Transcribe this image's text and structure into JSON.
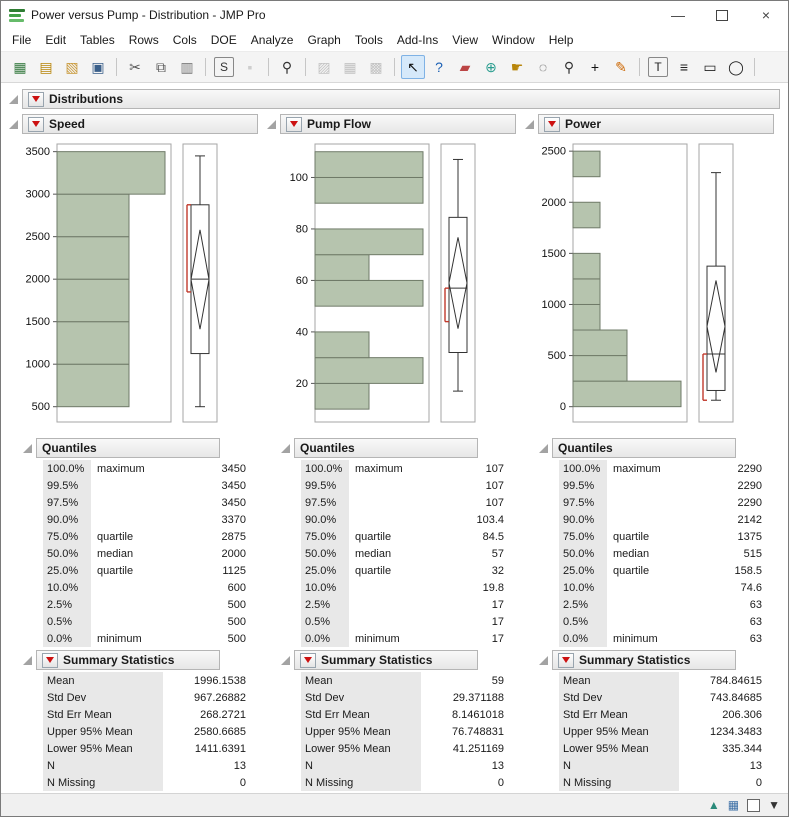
{
  "window": {
    "title": "Power versus Pump - Distribution - JMP Pro",
    "minimize_glyph": "—",
    "close_glyph": "×"
  },
  "menu": [
    "File",
    "Edit",
    "Tables",
    "Rows",
    "Cols",
    "DOE",
    "Analyze",
    "Graph",
    "Tools",
    "Add-Ins",
    "View",
    "Window",
    "Help"
  ],
  "toolbar": {
    "items": [
      {
        "name": "new-data-table-icon",
        "glyph": "▦",
        "color": "#3a7d44"
      },
      {
        "name": "new-journal-icon",
        "glyph": "▤",
        "color": "#b8860b"
      },
      {
        "name": "open-icon",
        "glyph": "▧",
        "color": "#c89838"
      },
      {
        "name": "save-icon",
        "glyph": "▣",
        "color": "#3a5f8a"
      },
      {
        "sep": true
      },
      {
        "name": "cut-icon",
        "glyph": "✂",
        "color": "#555555"
      },
      {
        "name": "copy-icon",
        "glyph": "⧉",
        "color": "#555555"
      },
      {
        "name": "paste-icon",
        "glyph": "▥",
        "color": "#777777"
      },
      {
        "sep": true
      },
      {
        "name": "copy-script-icon",
        "glyph": "S",
        "color": "#333333",
        "boxed": true
      },
      {
        "name": "lock-icon",
        "glyph": "▪",
        "color": "#888888",
        "disabled": true
      },
      {
        "sep": true
      },
      {
        "name": "search-icon",
        "glyph": "⚲",
        "color": "#333333"
      },
      {
        "sep": true
      },
      {
        "name": "paste-special-icon",
        "glyph": "▨",
        "disabled": true,
        "color": "#666666"
      },
      {
        "name": "copy-table-icon",
        "glyph": "▦",
        "disabled": true,
        "color": "#666666"
      },
      {
        "name": "copy-graph-icon",
        "glyph": "▩",
        "disabled": true,
        "color": "#666666"
      },
      {
        "sep": true
      },
      {
        "name": "arrow-tool-icon",
        "glyph": "↖",
        "selected": true,
        "color": "#111111"
      },
      {
        "name": "help-tool-icon",
        "glyph": "?",
        "color": "#1a5fb4"
      },
      {
        "name": "brush-tool-icon",
        "glyph": "▰",
        "color": "#bb4444"
      },
      {
        "name": "globe-icon",
        "glyph": "⊕",
        "color": "#2a9d8f"
      },
      {
        "name": "grabber-tool-icon",
        "glyph": "☛",
        "color": "#b8860b"
      },
      {
        "name": "lasso-tool-icon",
        "glyph": "◌",
        "color": "#333333"
      },
      {
        "name": "magnifier-tool-icon",
        "glyph": "⚲",
        "color": "#333333"
      },
      {
        "name": "crosshair-tool-icon",
        "glyph": "+",
        "color": "#111111"
      },
      {
        "name": "pencil-tool-icon",
        "glyph": "✎",
        "color": "#cc6600"
      },
      {
        "sep": true
      },
      {
        "name": "annotate-icon",
        "glyph": "T",
        "color": "#222222",
        "boxed": true
      },
      {
        "name": "line-annotation-icon",
        "glyph": "≡",
        "color": "#222222"
      },
      {
        "name": "rectangle-annotation-icon",
        "glyph": "▭",
        "color": "#222222"
      },
      {
        "name": "oval-annotation-icon",
        "glyph": "◯",
        "color": "#222222"
      },
      {
        "sep": true
      }
    ]
  },
  "report": {
    "title": "Distributions"
  },
  "colors": {
    "bar_fill": "#b6c4ae",
    "bar_stroke": "#6f7a68",
    "axis_stroke": "#a5a5a5",
    "box_stroke": "#333333",
    "bracket": "#c0392b"
  },
  "distributions": [
    {
      "name": "Speed",
      "chart_data": {
        "type": "histogram+boxplot",
        "axis": {
          "min": 320,
          "max": 3590,
          "ticks": [
            500,
            1000,
            1500,
            2000,
            2500,
            3000,
            3500
          ]
        },
        "bins": [
          {
            "lo": 500,
            "hi": 1000,
            "count": 2
          },
          {
            "lo": 1000,
            "hi": 1500,
            "count": 2
          },
          {
            "lo": 1500,
            "hi": 2000,
            "count": 2
          },
          {
            "lo": 2000,
            "hi": 2500,
            "count": 2
          },
          {
            "lo": 2500,
            "hi": 3000,
            "count": 2
          },
          {
            "lo": 3000,
            "hi": 3500,
            "count": 3
          }
        ],
        "boxplot": {
          "min": 500,
          "q1": 1125,
          "median": 2000,
          "q3": 2875,
          "max": 3450,
          "mean": 1996.1538,
          "ci_low": 1411.6391,
          "ci_high": 2580.6685,
          "shortest_half": [
            1850,
            2875
          ]
        }
      },
      "quantiles": {
        "title": "Quantiles",
        "rows": [
          [
            "100.0%",
            "maximum",
            "3450"
          ],
          [
            "99.5%",
            "",
            "3450"
          ],
          [
            "97.5%",
            "",
            "3450"
          ],
          [
            "90.0%",
            "",
            "3370"
          ],
          [
            "75.0%",
            "quartile",
            "2875"
          ],
          [
            "50.0%",
            "median",
            "2000"
          ],
          [
            "25.0%",
            "quartile",
            "1125"
          ],
          [
            "10.0%",
            "",
            "600"
          ],
          [
            "2.5%",
            "",
            "500"
          ],
          [
            "0.5%",
            "",
            "500"
          ],
          [
            "0.0%",
            "minimum",
            "500"
          ]
        ]
      },
      "summary": {
        "title": "Summary Statistics",
        "rows": [
          [
            "Mean",
            "1996.1538"
          ],
          [
            "Std Dev",
            "967.26882"
          ],
          [
            "Std Err Mean",
            "268.2721"
          ],
          [
            "Upper 95% Mean",
            "2580.6685"
          ],
          [
            "Lower 95% Mean",
            "1411.6391"
          ],
          [
            "N",
            "13"
          ],
          [
            "N Missing",
            "0"
          ]
        ]
      }
    },
    {
      "name": "Pump Flow",
      "chart_data": {
        "type": "histogram+boxplot",
        "axis": {
          "min": 5,
          "max": 113,
          "ticks": [
            20,
            40,
            60,
            80,
            100
          ]
        },
        "bins": [
          {
            "lo": 10,
            "hi": 20,
            "count": 1
          },
          {
            "lo": 20,
            "hi": 30,
            "count": 2
          },
          {
            "lo": 30,
            "hi": 40,
            "count": 1
          },
          {
            "lo": 40,
            "hi": 50,
            "count": 0
          },
          {
            "lo": 50,
            "hi": 60,
            "count": 2
          },
          {
            "lo": 60,
            "hi": 70,
            "count": 1
          },
          {
            "lo": 70,
            "hi": 80,
            "count": 2
          },
          {
            "lo": 80,
            "hi": 90,
            "count": 0
          },
          {
            "lo": 90,
            "hi": 100,
            "count": 2
          },
          {
            "lo": 100,
            "hi": 110,
            "count": 2
          }
        ],
        "boxplot": {
          "min": 17,
          "q1": 32,
          "median": 57,
          "q3": 84.5,
          "max": 107,
          "mean": 59,
          "ci_low": 41.251169,
          "ci_high": 76.748831,
          "shortest_half": [
            44,
            57
          ]
        }
      },
      "quantiles": {
        "title": "Quantiles",
        "rows": [
          [
            "100.0%",
            "maximum",
            "107"
          ],
          [
            "99.5%",
            "",
            "107"
          ],
          [
            "97.5%",
            "",
            "107"
          ],
          [
            "90.0%",
            "",
            "103.4"
          ],
          [
            "75.0%",
            "quartile",
            "84.5"
          ],
          [
            "50.0%",
            "median",
            "57"
          ],
          [
            "25.0%",
            "quartile",
            "32"
          ],
          [
            "10.0%",
            "",
            "19.8"
          ],
          [
            "2.5%",
            "",
            "17"
          ],
          [
            "0.5%",
            "",
            "17"
          ],
          [
            "0.0%",
            "minimum",
            "17"
          ]
        ]
      },
      "summary": {
        "title": "Summary Statistics",
        "rows": [
          [
            "Mean",
            "59"
          ],
          [
            "Std Dev",
            "29.371188"
          ],
          [
            "Std Err Mean",
            "8.1461018"
          ],
          [
            "Upper 95% Mean",
            "76.748831"
          ],
          [
            "Lower 95% Mean",
            "41.251169"
          ],
          [
            "N",
            "13"
          ],
          [
            "N Missing",
            "0"
          ]
        ]
      }
    },
    {
      "name": "Power",
      "chart_data": {
        "type": "histogram+boxplot",
        "axis": {
          "min": -150,
          "max": 2570,
          "ticks": [
            0,
            500,
            1000,
            1500,
            2000,
            2500
          ]
        },
        "bins": [
          {
            "lo": 0,
            "hi": 250,
            "count": 4
          },
          {
            "lo": 250,
            "hi": 500,
            "count": 2
          },
          {
            "lo": 500,
            "hi": 750,
            "count": 2
          },
          {
            "lo": 750,
            "hi": 1000,
            "count": 1
          },
          {
            "lo": 1000,
            "hi": 1250,
            "count": 1
          },
          {
            "lo": 1250,
            "hi": 1500,
            "count": 1
          },
          {
            "lo": 1500,
            "hi": 1750,
            "count": 0
          },
          {
            "lo": 1750,
            "hi": 2000,
            "count": 1
          },
          {
            "lo": 2000,
            "hi": 2250,
            "count": 0
          },
          {
            "lo": 2250,
            "hi": 2500,
            "count": 1
          }
        ],
        "boxplot": {
          "min": 63,
          "q1": 158.5,
          "median": 515,
          "q3": 1375,
          "max": 2290,
          "mean": 784.84615,
          "ci_low": 335.344,
          "ci_high": 1234.3483,
          "shortest_half": [
            63,
            515
          ]
        }
      },
      "quantiles": {
        "title": "Quantiles",
        "rows": [
          [
            "100.0%",
            "maximum",
            "2290"
          ],
          [
            "99.5%",
            "",
            "2290"
          ],
          [
            "97.5%",
            "",
            "2290"
          ],
          [
            "90.0%",
            "",
            "2142"
          ],
          [
            "75.0%",
            "quartile",
            "1375"
          ],
          [
            "50.0%",
            "median",
            "515"
          ],
          [
            "25.0%",
            "quartile",
            "158.5"
          ],
          [
            "10.0%",
            "",
            "74.6"
          ],
          [
            "2.5%",
            "",
            "63"
          ],
          [
            "0.5%",
            "",
            "63"
          ],
          [
            "0.0%",
            "minimum",
            "63"
          ]
        ]
      },
      "summary": {
        "title": "Summary Statistics",
        "rows": [
          [
            "Mean",
            "784.84615"
          ],
          [
            "Std Dev",
            "743.84685"
          ],
          [
            "Std Err Mean",
            "206.306"
          ],
          [
            "Upper 95% Mean",
            "1234.3483"
          ],
          [
            "Lower 95% Mean",
            "335.344"
          ],
          [
            "N",
            "13"
          ],
          [
            "N Missing",
            "0"
          ]
        ]
      }
    }
  ],
  "statusbar": {
    "icons": [
      {
        "name": "scroll-to-top-icon",
        "glyph": "▲",
        "color": "#2a8a7a"
      },
      {
        "name": "data-table-icon",
        "glyph": "▦",
        "color": "#3a6ea5"
      },
      {
        "name": "window-selector-icon",
        "glyph": "",
        "box": true
      },
      {
        "name": "resize-grip-icon",
        "glyph": "▼",
        "color": "#333333"
      }
    ]
  }
}
